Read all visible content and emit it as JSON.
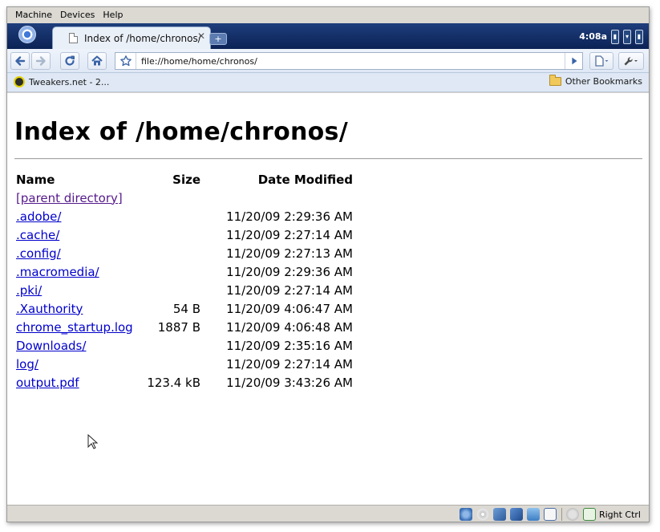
{
  "vm": {
    "menu": [
      "Machine",
      "Devices",
      "Help"
    ],
    "host_key_label": "Right Ctrl",
    "status_icons": [
      "hard-disk-icon",
      "cd-drive-icon",
      "network-icon",
      "usb-icon",
      "shared-folder-icon",
      "virtualization-icon",
      "mouse-integration-icon",
      "host-key-icon"
    ]
  },
  "browser": {
    "tab_title": "Index of /home/chronos/",
    "clock": "4:08a",
    "url": "file://home/home/chronos/",
    "bookmarks": [
      {
        "label": "Tweakers.net - 2..."
      }
    ],
    "other_bookmarks": "Other Bookmarks"
  },
  "page": {
    "title": "Index of /home/chronos/",
    "columns": [
      "Name",
      "Size",
      "Date Modified"
    ],
    "parent_link": "[parent directory]",
    "rows": [
      {
        "name": ".adobe/",
        "size": "",
        "date": "11/20/09 2:29:36 AM"
      },
      {
        "name": ".cache/",
        "size": "",
        "date": "11/20/09 2:27:14 AM"
      },
      {
        "name": ".config/",
        "size": "",
        "date": "11/20/09 2:27:13 AM"
      },
      {
        "name": ".macromedia/",
        "size": "",
        "date": "11/20/09 2:29:36 AM"
      },
      {
        "name": ".pki/",
        "size": "",
        "date": "11/20/09 2:27:14 AM"
      },
      {
        "name": ".Xauthority",
        "size": "54 B",
        "date": "11/20/09 4:06:47 AM"
      },
      {
        "name": "chrome_startup.log",
        "size": "1887 B",
        "date": "11/20/09 4:06:48 AM"
      },
      {
        "name": "Downloads/",
        "size": "",
        "date": "11/20/09 2:35:16 AM"
      },
      {
        "name": "log/",
        "size": "",
        "date": "11/20/09 2:27:14 AM"
      },
      {
        "name": "output.pdf",
        "size": "123.4 kB",
        "date": "11/20/09 3:43:26 AM"
      }
    ]
  },
  "colors": {
    "link": "#0000cc",
    "visited_link": "#551a8b",
    "tabstrip": "#0b2255"
  }
}
